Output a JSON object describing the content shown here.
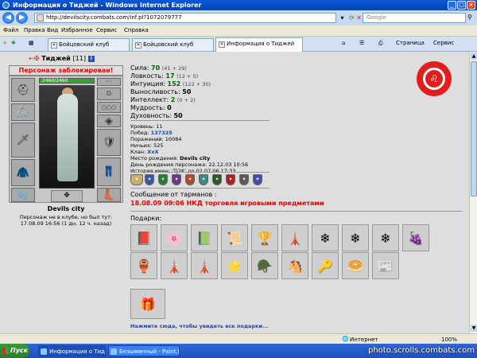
{
  "window": {
    "title": "Информация о Тиджей - Windows Internet Explorer",
    "controls": [
      "_",
      "□",
      "×"
    ]
  },
  "address": {
    "url": "http://devilscity.combats.com/inf.pl?1072079777",
    "search_placeholder": "Google"
  },
  "menu": [
    "Файл",
    "Правка",
    "Вид",
    "Избранное",
    "Сервис",
    "Справка"
  ],
  "tabs": [
    {
      "label": "Бойцовский клуб",
      "active": false
    },
    {
      "label": "Бойцовский клуб",
      "active": false
    },
    {
      "label": "Информация о Тиджей",
      "active": true
    }
  ],
  "toolbar": {
    "page_label": "Страница",
    "tools_label": "Сервис"
  },
  "character": {
    "name": "Тиджей",
    "level": "[11]",
    "info_icon": "i",
    "blocked": "Персонаж заблокирован!",
    "hp": "2460/2460",
    "city": "Devils city",
    "presence_line1": "Персонаж не в клубе, но был тут:",
    "presence_line2": "17.08.09 16:56 (1 дн. 12 ч. назад)"
  },
  "stats": [
    {
      "label": "Сила:",
      "value": "70",
      "bonus": "(41 + 29)",
      "green": true
    },
    {
      "label": "Ловкость:",
      "value": "17",
      "bonus": "(12 + 5)",
      "green": true
    },
    {
      "label": "Интуиция:",
      "value": "152",
      "bonus": "(122 + 30)",
      "green": true
    },
    {
      "label": "Выносливость:",
      "value": "50",
      "bonus": "",
      "green": false
    },
    {
      "label": "Интеллект:",
      "value": "2",
      "bonus": "(0 + 2)",
      "green": true
    },
    {
      "label": "Мудрость:",
      "value": "0",
      "bonus": "",
      "green": false
    },
    {
      "label": "Духовность:",
      "value": "50",
      "bonus": "",
      "green": false
    }
  ],
  "info": {
    "level_label": "Уровень:",
    "level": "11",
    "wins_label": "Побед:",
    "wins": "137325",
    "losses_label": "Поражений:",
    "losses": "10084",
    "draws_label": "Ничьих:",
    "draws": "525",
    "clan_label": "Клан:",
    "clan": "XxX",
    "birthplace_label": "Место рождения:",
    "birthplace": "Devils city",
    "birthday_label": "День рождения персонажа:",
    "birthday": "22.12.03 10:56",
    "history_label": "История имен:",
    "history": "'TJ2K' до 02.07.06 17:33"
  },
  "badges": [
    "#c8b070",
    "#3a5aa0",
    "#2a7a3a",
    "#6a3a8a",
    "#b04a2a",
    "#3a8a8a",
    "#2a5a2a",
    "#aa2222",
    "#5a5a5a",
    "#4a4aaa"
  ],
  "tarmans": {
    "label": "Сообщение от тарманов :",
    "message": "18.08.09 09:06 НКД торговля игровыми предметами"
  },
  "gifts": {
    "label": "Подарки:",
    "items": [
      "📕",
      "🌸",
      "📗",
      "📜",
      "🏆",
      "🗼",
      "❄",
      "❄",
      "❄",
      "🍇",
      "🏺",
      "🗼",
      "🗼",
      "⭐",
      "🪖",
      "🐴",
      "🔑",
      "🥯",
      "📰",
      "🎁"
    ],
    "more_link": "Нажмите сюда, чтобы увидеть все подарки..."
  },
  "status": {
    "zone": "Интернет",
    "zoom": "100%"
  },
  "taskbar": {
    "start": "Пуск",
    "tasks": [
      "Информация о Тиджей...",
      "Безымянный - Paint.NET..."
    ],
    "watermark": "photo.scrolls.combats.com"
  },
  "colors": {
    "accent": "#e00000",
    "stat_green": "#006600",
    "link": "#2244aa"
  }
}
